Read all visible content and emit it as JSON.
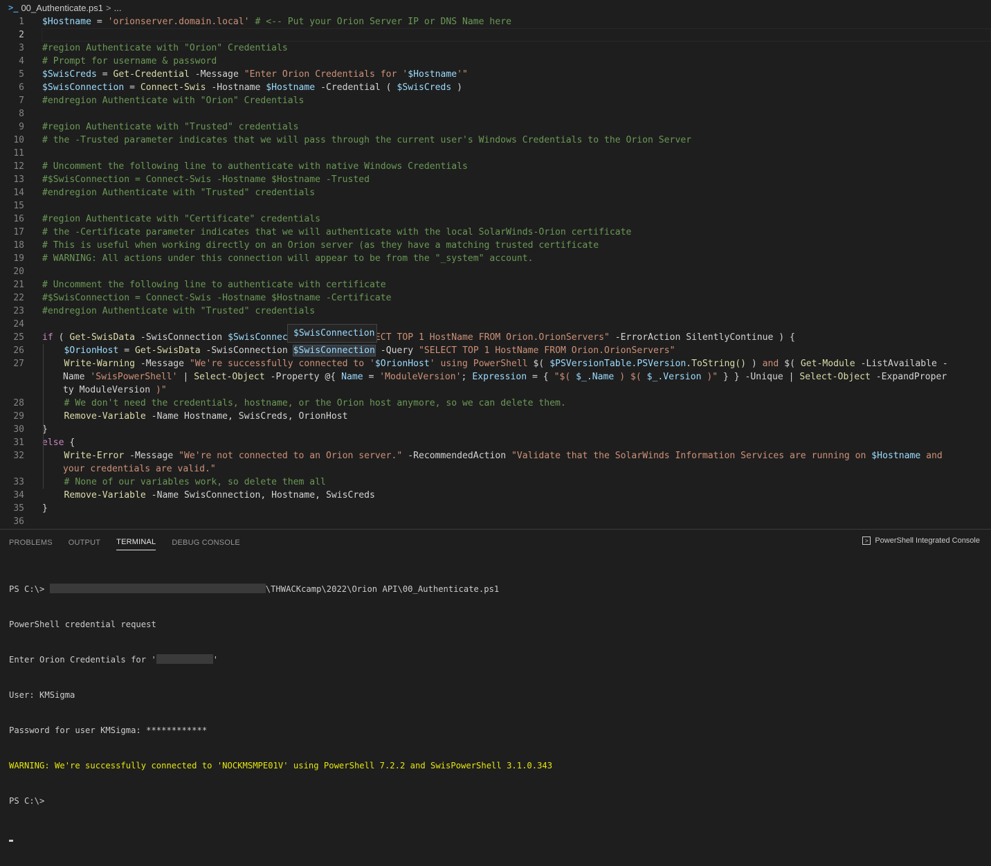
{
  "breadcrumb": {
    "file": "00_Authenticate.ps1",
    "separator": ">",
    "ellipsis": "..."
  },
  "editor": {
    "active_line": 2,
    "hover_tooltip": "$SwisConnection",
    "lines": [
      {
        "n": "1",
        "tokens": [
          [
            "var",
            "$Hostname"
          ],
          [
            "op",
            " = "
          ],
          [
            "str",
            "'orionserver.domain.local'"
          ],
          [
            "cmt",
            " # <-- Put your Orion Server IP or DNS Name here"
          ]
        ]
      },
      {
        "n": "2",
        "tokens": []
      },
      {
        "n": "3",
        "tokens": [
          [
            "cmt",
            "#region Authenticate with \"Orion\" Credentials"
          ]
        ]
      },
      {
        "n": "4",
        "tokens": [
          [
            "cmt",
            "# Prompt for username & password"
          ]
        ]
      },
      {
        "n": "5",
        "tokens": [
          [
            "var",
            "$SwisCreds"
          ],
          [
            "op",
            " = "
          ],
          [
            "fn",
            "Get-Credential"
          ],
          [
            "op",
            " -Message "
          ],
          [
            "str",
            "\"Enter Orion Credentials for '"
          ],
          [
            "var",
            "$Hostname"
          ],
          [
            "str",
            "'\""
          ]
        ]
      },
      {
        "n": "6",
        "tokens": [
          [
            "var",
            "$SwisConnection"
          ],
          [
            "op",
            " = "
          ],
          [
            "fn",
            "Connect-Swis"
          ],
          [
            "op",
            " -Hostname "
          ],
          [
            "var",
            "$Hostname"
          ],
          [
            "op",
            " -Credential ( "
          ],
          [
            "var",
            "$SwisCreds"
          ],
          [
            "op",
            " )"
          ]
        ]
      },
      {
        "n": "7",
        "tokens": [
          [
            "cmt",
            "#endregion Authenticate with \"Orion\" Credentials"
          ]
        ]
      },
      {
        "n": "8",
        "tokens": []
      },
      {
        "n": "9",
        "tokens": [
          [
            "cmt",
            "#region Authenticate with \"Trusted\" credentials"
          ]
        ]
      },
      {
        "n": "10",
        "tokens": [
          [
            "cmt",
            "# the -Trusted parameter indicates that we will pass through the current user's Windows Credentials to the Orion Server"
          ]
        ]
      },
      {
        "n": "11",
        "tokens": []
      },
      {
        "n": "12",
        "tokens": [
          [
            "cmt",
            "# Uncomment the following line to authenticate with native Windows Credentials"
          ]
        ]
      },
      {
        "n": "13",
        "tokens": [
          [
            "cmt",
            "#$SwisConnection = Connect-Swis -Hostname $Hostname -Trusted"
          ]
        ]
      },
      {
        "n": "14",
        "tokens": [
          [
            "cmt",
            "#endregion Authenticate with \"Trusted\" credentials"
          ]
        ]
      },
      {
        "n": "15",
        "tokens": []
      },
      {
        "n": "16",
        "tokens": [
          [
            "cmt",
            "#region Authenticate with \"Certificate\" credentials"
          ]
        ]
      },
      {
        "n": "17",
        "tokens": [
          [
            "cmt",
            "# the -Certificate parameter indicates that we will authenticate with the local SolarWinds-Orion certificate"
          ]
        ]
      },
      {
        "n": "18",
        "tokens": [
          [
            "cmt",
            "# This is useful when working directly on an Orion server (as they have a matching trusted certificate"
          ]
        ]
      },
      {
        "n": "19",
        "tokens": [
          [
            "cmt",
            "# WARNING: All actions under this connection will appear to be from the \"_system\" account."
          ]
        ]
      },
      {
        "n": "20",
        "tokens": []
      },
      {
        "n": "21",
        "tokens": [
          [
            "cmt",
            "# Uncomment the following line to authenticate with certificate"
          ]
        ]
      },
      {
        "n": "22",
        "tokens": [
          [
            "cmt",
            "#$SwisConnection = Connect-Swis -Hostname $Hostname -Certificate"
          ]
        ]
      },
      {
        "n": "23",
        "tokens": [
          [
            "cmt",
            "#endregion Authenticate with \"Trusted\" credentials"
          ]
        ]
      },
      {
        "n": "24",
        "tokens": []
      },
      {
        "n": "25",
        "tokens": [
          [
            "kw",
            "if"
          ],
          [
            "op",
            " ( "
          ],
          [
            "fn",
            "Get-SwisData"
          ],
          [
            "op",
            " -SwisConnection "
          ],
          [
            "var",
            "$SwisConnection"
          ],
          [
            "op",
            " -Query "
          ],
          [
            "str",
            "\"SELECT TOP 1 HostName FROM Orion.OrionServers\""
          ],
          [
            "op",
            " -ErrorAction SilentlyContinue ) {"
          ]
        ]
      },
      {
        "n": "26",
        "tokens": [
          [
            "op",
            "    "
          ],
          [
            "var",
            "$OrionHost"
          ],
          [
            "op",
            " = "
          ],
          [
            "fn",
            "Get-SwisData"
          ],
          [
            "op",
            " -SwisConnection "
          ],
          [
            "hl",
            "$SwisConnection"
          ],
          [
            "op",
            " -Query "
          ],
          [
            "str",
            "\"SELECT TOP 1 HostName FROM Orion.OrionServers\""
          ]
        ]
      },
      {
        "n": "27",
        "tokens": [
          [
            "op",
            "    "
          ],
          [
            "fn",
            "Write-Warning"
          ],
          [
            "op",
            " -Message "
          ],
          [
            "str",
            "\"We're successfully connected to '"
          ],
          [
            "var",
            "$OrionHost"
          ],
          [
            "str",
            "' using PowerShell "
          ],
          [
            "op",
            "$( "
          ],
          [
            "var",
            "$PSVersionTable.PSVersion"
          ],
          [
            "fn",
            ".ToString()"
          ],
          [
            "op",
            " ) "
          ],
          [
            "str",
            "and "
          ],
          [
            "op",
            "$( "
          ],
          [
            "fn",
            "Get-Module"
          ],
          [
            "op",
            " -ListAvailable -Name "
          ],
          [
            "str",
            "'SwisPowerShell'"
          ],
          [
            "op",
            " | "
          ],
          [
            "fn",
            "Select-Object"
          ],
          [
            "op",
            " -Property @{ "
          ],
          [
            "var",
            "Name"
          ],
          [
            "op",
            " = "
          ],
          [
            "str",
            "'ModuleVersion'"
          ],
          [
            "op",
            "; "
          ],
          [
            "var",
            "Expression"
          ],
          [
            "op",
            " = { "
          ],
          [
            "str",
            "\"$( "
          ],
          [
            "var",
            "$_.Name"
          ],
          [
            "str",
            " ) $( "
          ],
          [
            "var",
            "$_.Version"
          ],
          [
            "str",
            " )\""
          ],
          [
            "op",
            " } } -Unique | "
          ],
          [
            "fn",
            "Select-Object"
          ],
          [
            "op",
            " -ExpandProperty ModuleVersion "
          ],
          [
            "str",
            ")\""
          ]
        ]
      },
      {
        "n": "28",
        "tokens": [
          [
            "op",
            "    "
          ],
          [
            "cmt",
            "# We don't need the credentials, hostname, or the Orion host anymore, so we can delete them."
          ]
        ]
      },
      {
        "n": "29",
        "tokens": [
          [
            "op",
            "    "
          ],
          [
            "fn",
            "Remove-Variable"
          ],
          [
            "op",
            " -Name Hostname, SwisCreds, OrionHost"
          ]
        ]
      },
      {
        "n": "30",
        "tokens": [
          [
            "op",
            "}"
          ]
        ]
      },
      {
        "n": "31",
        "tokens": [
          [
            "kw",
            "else"
          ],
          [
            "op",
            " {"
          ]
        ]
      },
      {
        "n": "32",
        "tokens": [
          [
            "op",
            "    "
          ],
          [
            "fn",
            "Write-Error"
          ],
          [
            "op",
            " -Message "
          ],
          [
            "str",
            "\"We're not connected to an Orion server.\""
          ],
          [
            "op",
            " -RecommendedAction "
          ],
          [
            "str",
            "\"Validate that the SolarWinds Information Services are running on "
          ],
          [
            "var",
            "$Hostname"
          ],
          [
            "str",
            " and your credentials are valid.\""
          ]
        ]
      },
      {
        "n": "33",
        "tokens": [
          [
            "op",
            "    "
          ],
          [
            "cmt",
            "# None of our variables work, so delete them all"
          ]
        ]
      },
      {
        "n": "34",
        "tokens": [
          [
            "op",
            "    "
          ],
          [
            "fn",
            "Remove-Variable"
          ],
          [
            "op",
            " -Name SwisConnection, Hostname, SwisCreds"
          ]
        ]
      },
      {
        "n": "35",
        "tokens": [
          [
            "op",
            "}"
          ]
        ]
      },
      {
        "n": "36",
        "tokens": []
      }
    ]
  },
  "panel": {
    "tabs": [
      {
        "label": "PROBLEMS",
        "active": false
      },
      {
        "label": "OUTPUT",
        "active": false
      },
      {
        "label": "TERMINAL",
        "active": true
      },
      {
        "label": "DEBUG CONSOLE",
        "active": false
      }
    ],
    "console_name": "PowerShell Integrated Console",
    "terminal": {
      "prompt": "PS C:\\>",
      "path_tail": "\\THWACKcamp\\2022\\Orion API\\00_Authenticate.ps1",
      "line_cred_request": "PowerShell credential request",
      "line_enter_prefix": "Enter Orion Credentials for '",
      "line_enter_suffix": "'",
      "line_user": "User: KMSigma",
      "line_password": "Password for user KMSigma: ************",
      "line_warning": "WARNING: We're successfully connected to 'NOCKMSMPE01V' using PowerShell 7.2.2 and SwisPowerShell 3.1.0.343",
      "final_prompt": "PS C:\\>"
    }
  }
}
